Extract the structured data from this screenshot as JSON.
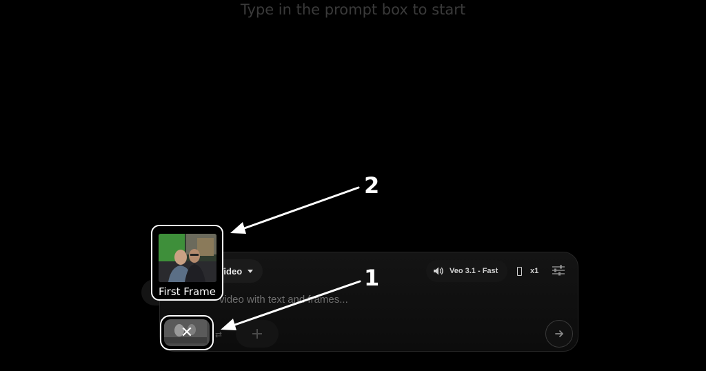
{
  "hint_text": "Type in the prompt box to start",
  "toolbar": {
    "mode_label": "Video",
    "model_label": "Veo 3.1 - Fast",
    "output_count": "x1"
  },
  "prompt": {
    "placeholder": "video with text and frames..."
  },
  "frame_card": {
    "label": "First Frame"
  },
  "callouts": {
    "one": "1",
    "two": "2"
  },
  "icons": {
    "remove": "close-icon",
    "add": "plus-icon",
    "send": "arrow-right-icon",
    "model": "speaker-icon",
    "settings": "tune-icon"
  },
  "colors": {
    "background": "#000000",
    "annotation": "#ffffff"
  }
}
